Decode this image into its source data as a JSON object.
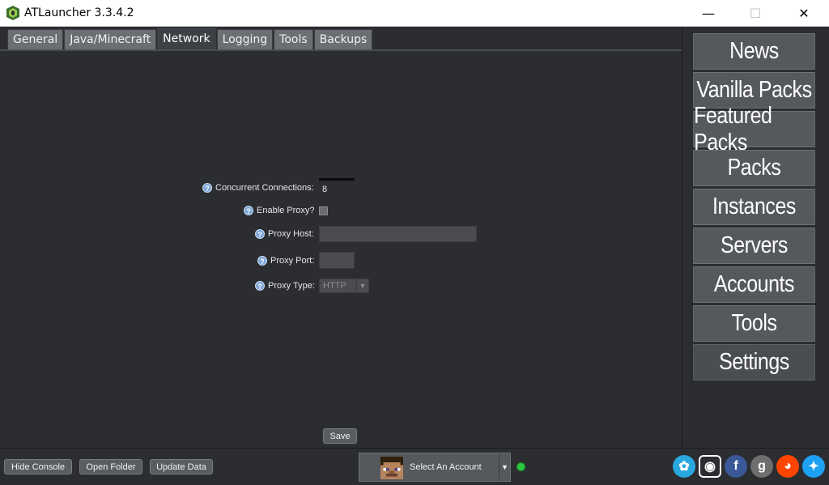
{
  "window": {
    "title": "ATLauncher 3.3.4.2",
    "minimize": "—",
    "maximize": "☐",
    "close": "✕"
  },
  "tabs": [
    {
      "label": "General"
    },
    {
      "label": "Java/Minecraft"
    },
    {
      "label": "Network",
      "active": true
    },
    {
      "label": "Logging"
    },
    {
      "label": "Tools"
    },
    {
      "label": "Backups"
    }
  ],
  "form": {
    "concurrent_connections": {
      "label": "Concurrent Connections:",
      "value": "8"
    },
    "enable_proxy": {
      "label": "Enable Proxy?",
      "checked": false
    },
    "proxy_host": {
      "label": "Proxy Host:",
      "value": ""
    },
    "proxy_port": {
      "label": "Proxy Port:",
      "value": ""
    },
    "proxy_type": {
      "label": "Proxy Type:",
      "value": "HTTP"
    },
    "help_glyph": "?",
    "save_label": "Save"
  },
  "sidebar": {
    "items": [
      {
        "label": "News"
      },
      {
        "label": "Vanilla Packs"
      },
      {
        "label": "Featured Packs"
      },
      {
        "label": "Packs"
      },
      {
        "label": "Instances"
      },
      {
        "label": "Servers"
      },
      {
        "label": "Accounts"
      },
      {
        "label": "Tools"
      },
      {
        "label": "Settings",
        "active": true
      }
    ]
  },
  "bottom": {
    "hide_console": "Hide Console",
    "open_folder": "Open Folder",
    "update_data": "Update Data",
    "account_label": "Select An Account",
    "dropdown_glyph": "▼",
    "status_color": "#2cc640"
  },
  "social": [
    {
      "name": "crowdin-icon",
      "color": "#29a8e0",
      "glyph": "✿"
    },
    {
      "name": "discord-icon",
      "color": "#2b2d30",
      "glyph": "◉"
    },
    {
      "name": "facebook-icon",
      "color": "#3b5998",
      "glyph": "f"
    },
    {
      "name": "github-icon",
      "color": "#6e6e6e",
      "glyph": "g"
    },
    {
      "name": "reddit-icon",
      "color": "#ff4500",
      "glyph": "◕"
    },
    {
      "name": "twitter-icon",
      "color": "#1da1f2",
      "glyph": "✦"
    }
  ]
}
